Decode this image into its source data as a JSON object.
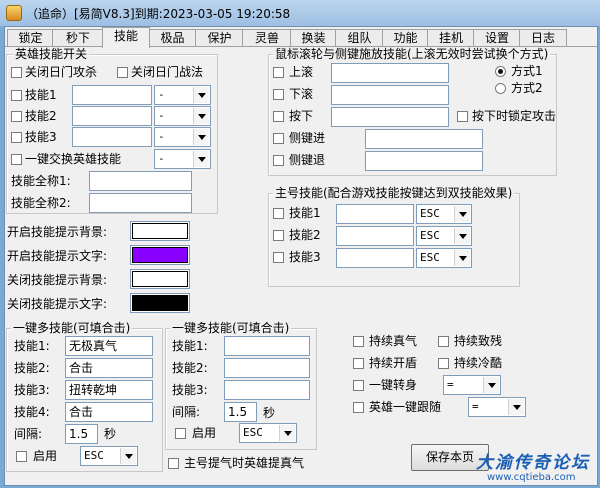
{
  "window": {
    "title": "（追命）[易简V8.3]到期:2023-03-05 19:20:58"
  },
  "tabs": [
    "锁定",
    "秒下",
    "技能",
    "极品",
    "保护",
    "灵兽",
    "换装",
    "组队",
    "功能",
    "挂机",
    "设置",
    "日志"
  ],
  "active_tab": "技能",
  "hero_group": {
    "title": "英雄技能开关",
    "close_attack": "关闭日门攻杀",
    "close_battle": "关闭日门战法",
    "skill1": "技能1",
    "skill2": "技能2",
    "skill3": "技能3",
    "dash": "-",
    "swap": "一键交换英雄技能",
    "fullname1": "技能全称1:",
    "fullname2": "技能全称2:"
  },
  "colors_section": {
    "on_bg": "开启技能提示背景:",
    "on_text": "开启技能提示文字:",
    "off_bg": "关闭技能提示背景:",
    "off_text": "关闭技能提示文字:",
    "on_bg_color": "#ffffff",
    "on_text_color": "#8a00ff",
    "off_bg_color": "#ffffff",
    "off_text_color": "#000000"
  },
  "mouse_group": {
    "title": "鼠标滚轮与侧键施放技能(上滚无效时尝试换个方式)",
    "up": "上滚",
    "down": "下滚",
    "press": "按下",
    "side_fwd": "侧键进",
    "side_back": "侧键退",
    "mode1": "方式1",
    "mode2": "方式2",
    "lock_attack": "按下时锁定攻击"
  },
  "main_group": {
    "title": "主号技能(配合游戏技能按键达到双技能效果)",
    "skill1": "技能1",
    "skill2": "技能2",
    "skill3": "技能3",
    "esc": "ESC"
  },
  "combo1": {
    "title": "一键多技能(可填合击)",
    "l1": "技能1:",
    "l2": "技能2:",
    "l3": "技能3:",
    "l4": "技能4:",
    "v1": "无极真气",
    "v2": "合击",
    "v3": "扭转乾坤",
    "v4": "合击",
    "interval": "间隔:",
    "interval_val": "1.5",
    "sec": "秒",
    "enable": "启用",
    "esc": "ESC"
  },
  "combo2": {
    "title": "一键多技能(可填合击)",
    "l1": "技能1:",
    "l2": "技能2:",
    "l3": "技能3:",
    "interval": "间隔:",
    "interval_val": "1.5",
    "sec": "秒",
    "enable": "启用",
    "esc": "ESC"
  },
  "right_opts": {
    "sustain_qi": "持续真气",
    "sustain_disable": "持续致残",
    "sustain_shield": "持续开盾",
    "sustain_cool": "持续冷酷",
    "one_transform": "一键转身",
    "hero_follow": "英雄一键跟随",
    "eq": "="
  },
  "bottom": {
    "hero_hint": "主号提气时英雄提真气",
    "save": "保存本页"
  },
  "watermark": {
    "main": "大渝传奇论坛",
    "url": "www.cqtieba.com"
  }
}
